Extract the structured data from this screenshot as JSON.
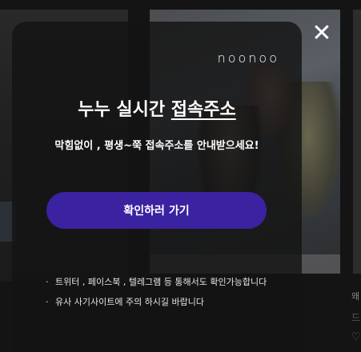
{
  "modal": {
    "logo": "noonoo",
    "title_plain": "누누 실시간 ",
    "title_underlined": "접속주소",
    "subtitle": "막힘없이 , 평생~쭉 접속주소를 안내받으세요!",
    "cta_label": "확인하러 가기",
    "notes": [
      "트위터 , 페이스북 , 텔레그램 등 통해서도 확인가능합니다",
      "유사 사기사이트에 주의 하시길 바랍니다"
    ],
    "bullet": "·",
    "close_symbol": "✕",
    "accent_color": "#3b22a0"
  },
  "side": {
    "text1": "왜",
    "text2": "드",
    "heart": "♡"
  }
}
